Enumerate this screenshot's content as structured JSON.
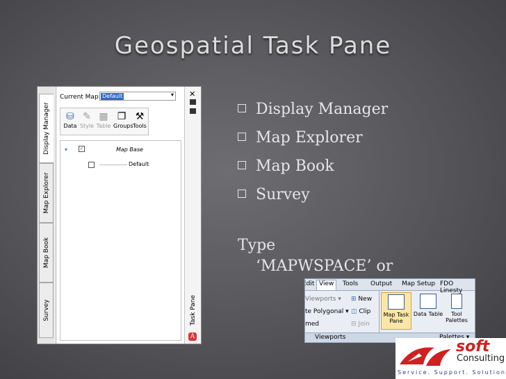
{
  "slide": {
    "title": "Geospatial Task Pane",
    "bullets": [
      "Display Manager",
      "Map Explorer",
      "Map Book",
      "Survey"
    ],
    "type_line1": "Type",
    "type_line2": "‘MAPWSPACE’ or"
  },
  "task_pane": {
    "vertical_tabs": [
      "Display Manager",
      "Map Explorer",
      "Map Book",
      "Survey"
    ],
    "current_map_label": "Current Map:",
    "current_map_value": "Default",
    "tools": [
      "Data",
      "Style",
      "Table",
      "Groups",
      "Tools"
    ],
    "tree": {
      "root": "Map Base",
      "child": "Default"
    },
    "side_label": "Task Pane",
    "close_glyph": "✕"
  },
  "ribbon": {
    "tabs": [
      "Edit",
      "View",
      "Tools",
      "Output",
      "Map Setup",
      "FDO Linesty"
    ],
    "active_tab": "View",
    "items": {
      "viewports": "Viewports",
      "polygonal": "te Polygonal",
      "named": "med",
      "new": "New",
      "clip": "Clip",
      "join": "Join"
    },
    "big_buttons": [
      "Map Task Pane",
      "Data Table",
      "Tool Palettes"
    ],
    "group_labels": {
      "viewports": "Viewports",
      "palettes": "Palettes"
    }
  },
  "logo": {
    "name": "soft",
    "sub": "Consulting",
    "tagline": "Service. Support. Solutions"
  },
  "colors": {
    "background": "#5a5a5e",
    "title": "#dcdcdc",
    "logo_red": "#d12020",
    "logo_blue": "#1e3f8f"
  }
}
